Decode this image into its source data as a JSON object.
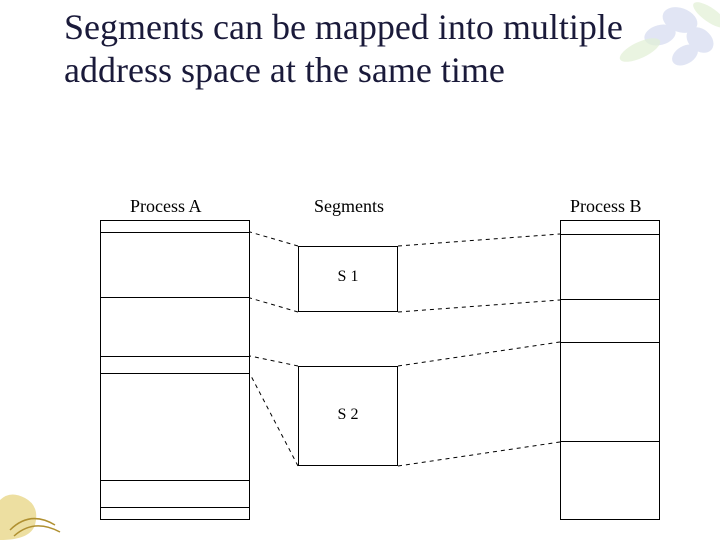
{
  "title": "Segments can be mapped into multiple address space at the same time",
  "labels": {
    "processA": "Process A",
    "segments": "Segments",
    "processB": "Process B",
    "s1": "S 1",
    "s2": "S 2"
  }
}
